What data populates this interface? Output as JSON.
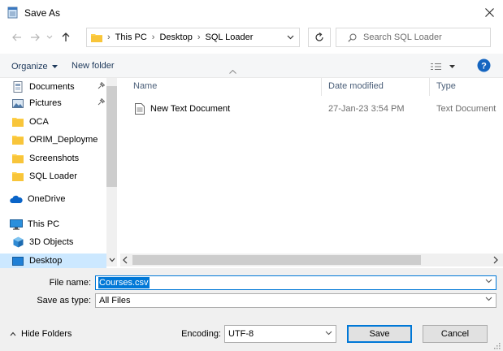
{
  "window": {
    "title": "Save As"
  },
  "nav": {
    "breadcrumb": [
      "This PC",
      "Desktop",
      "SQL Loader"
    ],
    "separator": "›",
    "search_placeholder": "Search SQL Loader"
  },
  "toolbar": {
    "organize": "Organize",
    "new_folder": "New folder"
  },
  "sidebar": {
    "items": [
      {
        "label": "Documents",
        "icon": "documents-icon"
      },
      {
        "label": "Pictures",
        "icon": "pictures-icon"
      },
      {
        "label": "OCA",
        "icon": "folder-icon"
      },
      {
        "label": "ORIM_Deployme",
        "icon": "folder-icon"
      },
      {
        "label": "Screenshots",
        "icon": "folder-icon"
      },
      {
        "label": "SQL Loader",
        "icon": "folder-icon"
      },
      {
        "label": "OneDrive",
        "icon": "cloud-icon"
      },
      {
        "label": "This PC",
        "icon": "computer-icon"
      },
      {
        "label": "3D Objects",
        "icon": "cube-icon"
      },
      {
        "label": "Desktop",
        "icon": "desktop-icon"
      }
    ]
  },
  "columns": {
    "name": "Name",
    "date": "Date modified",
    "type": "Type"
  },
  "files": [
    {
      "name": "New Text Document",
      "date": "27-Jan-23 3:54 PM",
      "type": "Text Document"
    }
  ],
  "form": {
    "filename_label": "File name:",
    "filename_value": "Courses.csv",
    "savetype_label": "Save as type:",
    "savetype_value": "All Files",
    "hide_folders": "Hide Folders",
    "encoding_label": "Encoding:",
    "encoding_value": "UTF-8",
    "save": "Save",
    "cancel": "Cancel"
  },
  "colors": {
    "accent": "#0078d7",
    "selection": "#cce8ff",
    "folder": "#ffd04a"
  }
}
